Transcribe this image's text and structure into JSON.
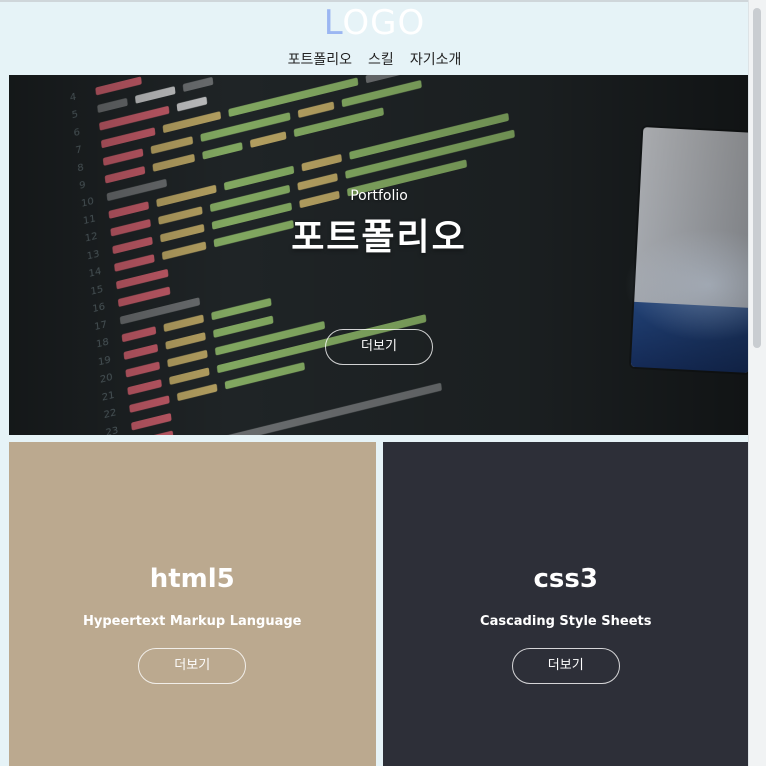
{
  "logo": {
    "first_letter": "L",
    "rest": "OGO"
  },
  "nav": {
    "items": [
      "포트폴리오",
      "스킬",
      "자기소개"
    ]
  },
  "hero": {
    "subtitle": "Portfolio",
    "title": "포트폴리오",
    "button_label": "더보기"
  },
  "cards": [
    {
      "title": "html5",
      "description": "Hypeertext Markup Language",
      "button_label": "더보기",
      "color": "#bba98f"
    },
    {
      "title": "css3",
      "description": "Cascading Style Sheets",
      "button_label": "더보기",
      "color": "#2d2f38"
    }
  ],
  "colors": {
    "page_bg": "#e6f3f7",
    "logo_accent": "#9bb6f2"
  },
  "icons": {
    "hero_image": "code-editor-photo"
  }
}
